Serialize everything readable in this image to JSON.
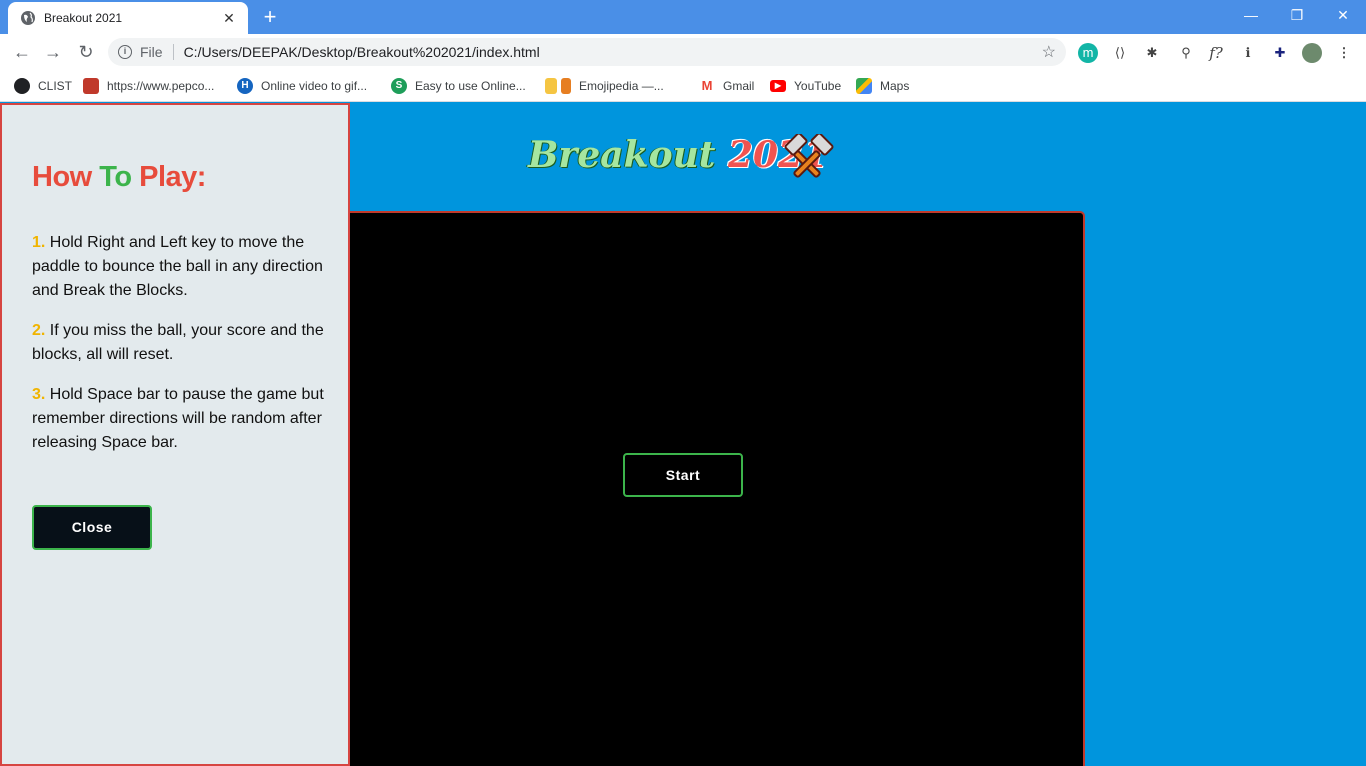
{
  "browser": {
    "tab_title": "Breakout 2021",
    "tab_close": "✕",
    "new_tab": "+",
    "window_controls": {
      "minimize": "—",
      "restore": "❐",
      "close": "✕"
    },
    "nav": {
      "back": "←",
      "forward": "→",
      "reload": "↻"
    },
    "address": {
      "scheme_label": "File",
      "url": "C:/Users/DEEPAK/Desktop/Breakout%202021/index.html"
    },
    "extensions": [
      "m",
      "⟨⟩",
      "✱",
      "⚲",
      "f?",
      "ℹ",
      "✚"
    ],
    "bookmarks": [
      {
        "label": "CLIST",
        "icon": "globe-icon",
        "color": "#202124"
      },
      {
        "label": "https://www.pepco...",
        "icon": "pepco-icon",
        "color": "#c0392b"
      },
      {
        "label": "Online video to gif...",
        "icon": "h-icon",
        "color": "#1565c0"
      },
      {
        "label": "Easy to use Online...",
        "icon": "s-icon",
        "color": "#1e9e5a"
      },
      {
        "label": "Emojipedia —...",
        "icon": "emojipedia-icon",
        "color": "#e67e22"
      },
      {
        "label": "Gmail",
        "icon": "gmail-icon",
        "color": "#ea4335"
      },
      {
        "label": "YouTube",
        "icon": "youtube-icon",
        "color": "#ff0000"
      },
      {
        "label": "Maps",
        "icon": "maps-icon",
        "color": "#34a853"
      }
    ]
  },
  "page": {
    "title_part1": "Breakout",
    "title_part2": "2021",
    "start_label": "Start",
    "rules": {
      "heading_part1": "How",
      "heading_part2": "To",
      "heading_part3": "Play:",
      "items": [
        {
          "num": "1.",
          "text": "Hold Right and Left key to move the paddle to bounce the ball in any direction and Break the Blocks."
        },
        {
          "num": "2.",
          "text": "If you miss the ball, your score and the blocks, all will reset."
        },
        {
          "num": "3.",
          "text": "Hold Space bar to pause the game but remember directions will be random after releasing Space bar."
        }
      ],
      "close_label": "Close"
    }
  },
  "colors": {
    "page_bg": "#0095dd",
    "tab_strip": "#4a8fe7",
    "accent_red": "#e74c3c",
    "accent_green": "#3cb44b",
    "accent_yellow": "#f0b400"
  }
}
